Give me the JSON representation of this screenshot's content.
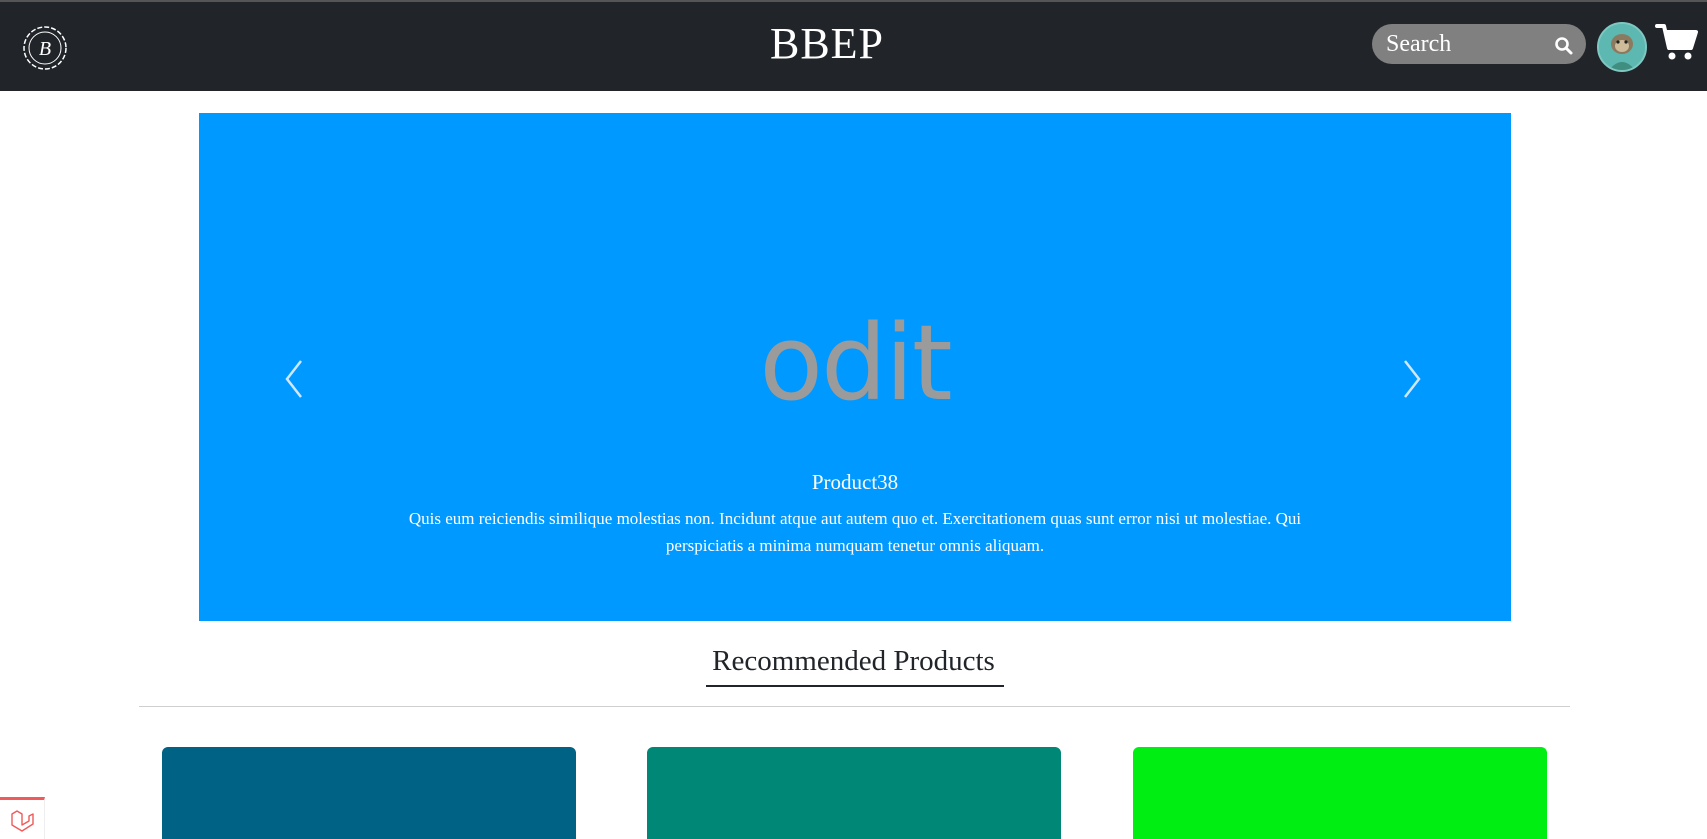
{
  "navbar": {
    "brand": "BBEP",
    "search_placeholder": "Search",
    "logo_icon": "bb-monogram-logo",
    "cart_icon": "shopping-cart-icon",
    "avatar_icon": "user-avatar"
  },
  "carousel": {
    "image_text": "odit",
    "title": "Product38",
    "description": "Quis eum reiciendis similique molestias non. Incidunt atque aut autem quo et. Exercitationem quas sunt error nisi ut molestiae. Qui perspiciatis a minima numquam tenetur omnis aliquam.",
    "background_color": "#0099ff"
  },
  "recommended": {
    "title": "Recommended Products",
    "cards": [
      {
        "color": "#006385"
      },
      {
        "color": "#008776"
      },
      {
        "color": "#00ee11"
      }
    ]
  },
  "colors": {
    "navbar": "#212429",
    "search_bg": "#808080"
  }
}
